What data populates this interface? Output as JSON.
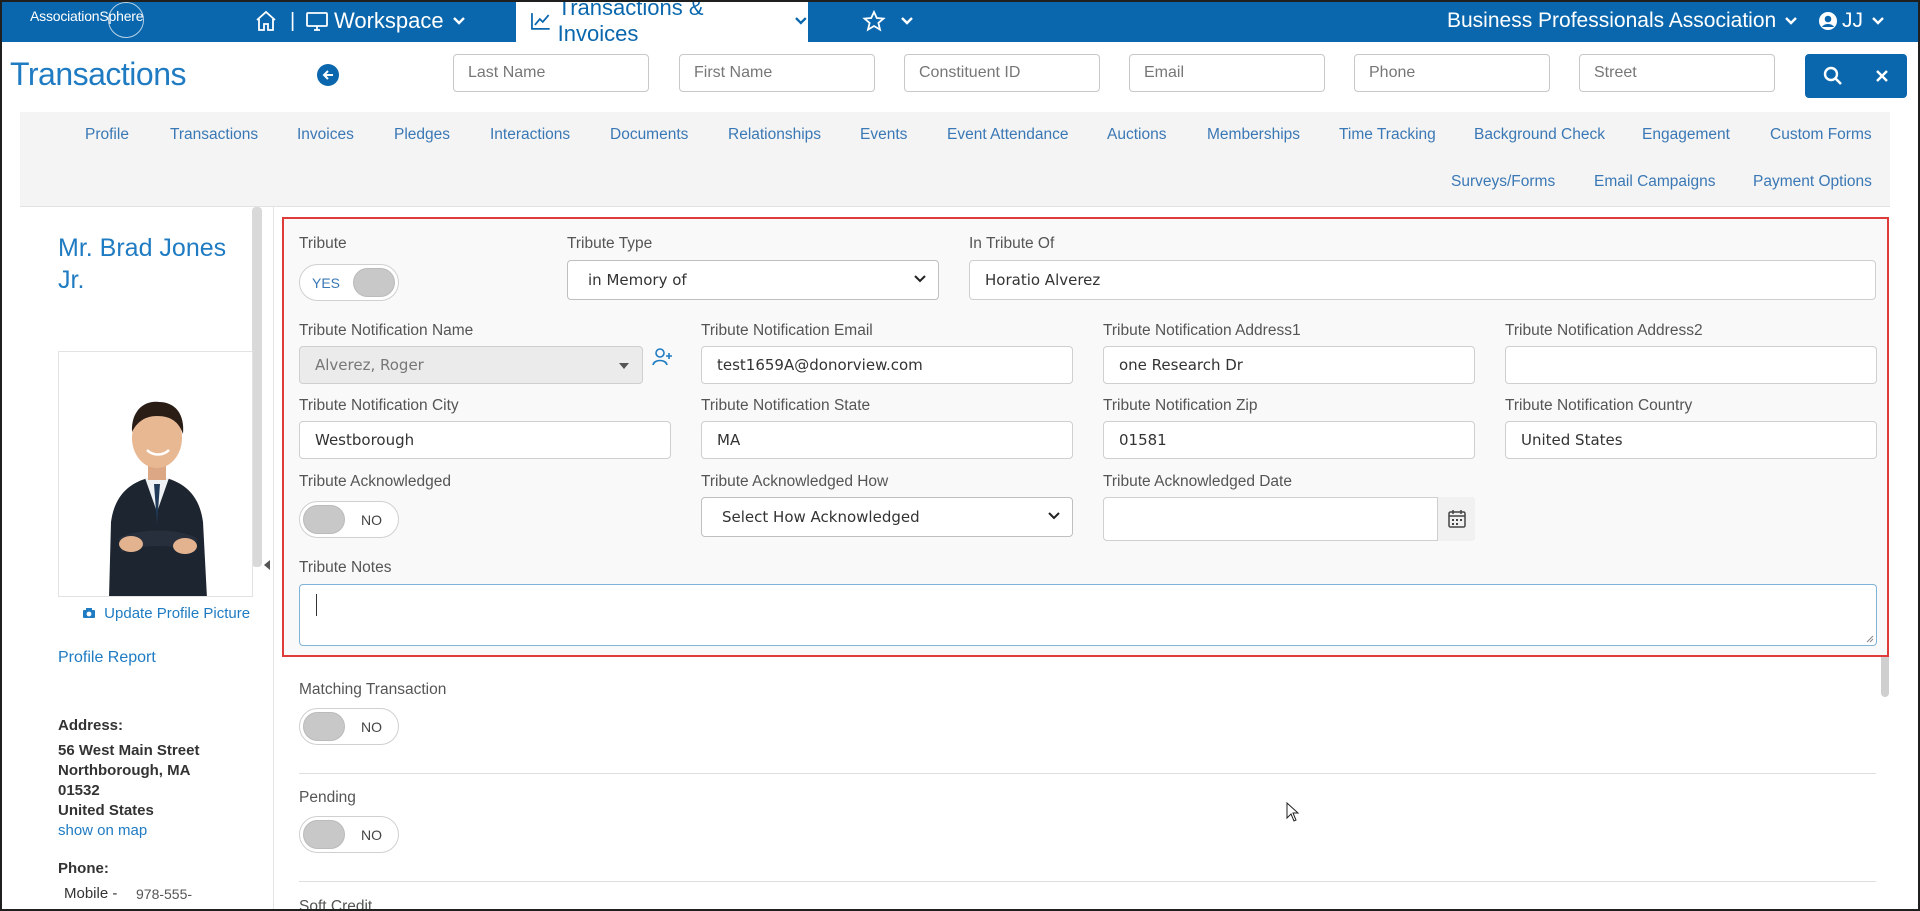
{
  "topnav": {
    "logo": "AssociationSphere",
    "workspace": "Workspace",
    "transactions_invoices": "Transactions & Invoices",
    "organization": "Business Professionals Association",
    "user_initials": "JJ",
    "separator": "|"
  },
  "header": {
    "title": "Transactions",
    "search_placeholders": {
      "last_name": "Last Name",
      "first_name": "First Name",
      "constituent_id": "Constituent ID",
      "email": "Email",
      "phone": "Phone",
      "street": "Street"
    }
  },
  "tabs": {
    "row1": [
      "Profile",
      "Transactions",
      "Invoices",
      "Pledges",
      "Interactions",
      "Documents",
      "Relationships",
      "Events",
      "Event Attendance",
      "Auctions",
      "Memberships",
      "Time Tracking",
      "Background Check",
      "Engagement",
      "Custom Forms"
    ],
    "row2": [
      "Surveys/Forms",
      "Email Campaigns",
      "Payment Options"
    ]
  },
  "profile": {
    "name_line1": "Mr. Brad Jones",
    "name_line2": "Jr.",
    "update_picture": "Update Profile Picture",
    "profile_report": "Profile Report",
    "address_label": "Address:",
    "address_line1": "56 West Main Street",
    "address_line2": "Northborough, MA",
    "address_line3": "01532",
    "address_line4": "United States",
    "show_on_map": "show on map",
    "phone_label": "Phone:",
    "mobile_label": "Mobile -",
    "mobile_value": "978-555-"
  },
  "tribute": {
    "tribute_label": "Tribute",
    "tribute_toggle": "YES",
    "type_label": "Tribute Type",
    "type_value": "in Memory of",
    "in_tribute_of_label": "In Tribute Of",
    "in_tribute_of_value": "Horatio Alverez",
    "notif_name_label": "Tribute Notification Name",
    "notif_name_value": "Alverez, Roger",
    "notif_email_label": "Tribute Notification Email",
    "notif_email_value": "test1659A@donorview.com",
    "notif_addr1_label": "Tribute Notification Address1",
    "notif_addr1_value": "one Research Dr",
    "notif_addr2_label": "Tribute Notification Address2",
    "notif_addr2_value": "",
    "notif_city_label": "Tribute Notification City",
    "notif_city_value": "Westborough",
    "notif_state_label": "Tribute Notification State",
    "notif_state_value": "MA",
    "notif_zip_label": "Tribute Notification Zip",
    "notif_zip_value": "01581",
    "notif_country_label": "Tribute Notification Country",
    "notif_country_value": "United States",
    "ack_label": "Tribute Acknowledged",
    "ack_toggle": "NO",
    "ack_how_label": "Tribute Acknowledged How",
    "ack_how_value": "Select How Acknowledged",
    "ack_date_label": "Tribute Acknowledged Date",
    "ack_date_value": "",
    "notes_label": "Tribute Notes"
  },
  "other": {
    "matching_label": "Matching Transaction",
    "matching_toggle": "NO",
    "pending_label": "Pending",
    "pending_toggle": "NO",
    "soft_credit_label": "Soft Credit"
  },
  "colors": {
    "primary": "#0a67ad",
    "link": "#1f7bc2",
    "highlight_border": "#e03b3b"
  }
}
